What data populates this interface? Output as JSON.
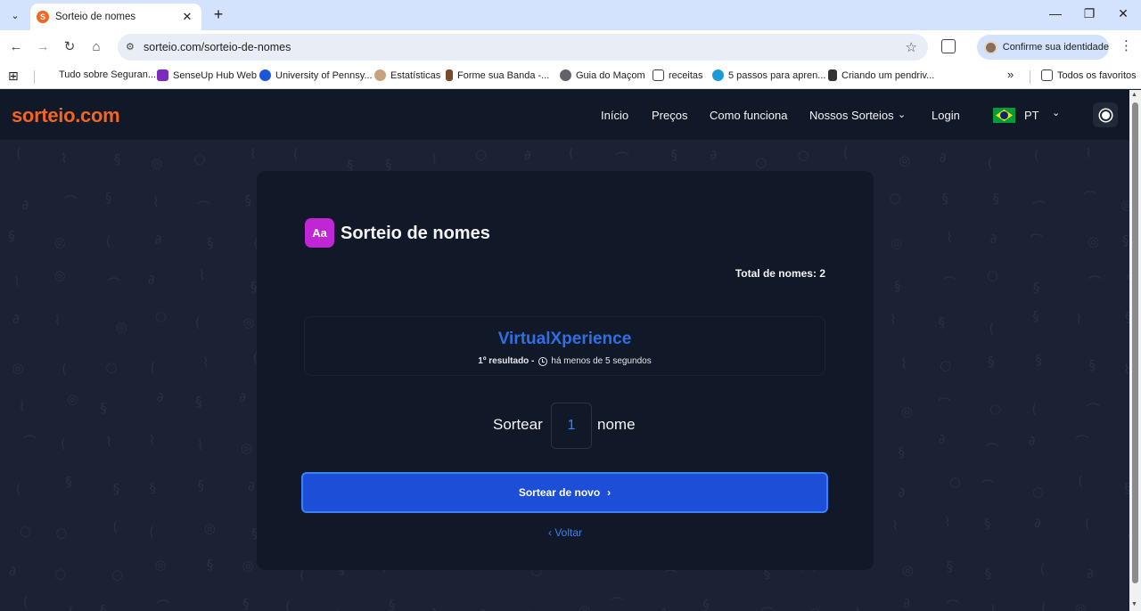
{
  "browser": {
    "tab": {
      "favicon": "S",
      "title": "Sorteio de nomes"
    },
    "address": "sorteio.com/sorteio-de-nomes",
    "profile": "Confirme sua identidade",
    "bookmarks": [
      "Tudo sobre Seguran...",
      "SenseUp Hub Web",
      "University of Pennsy...",
      "Estatísticas",
      "Forme sua Banda -...",
      "Guia do Maçom",
      "receitas",
      "5 passos para apren...",
      "Criando um pendriv..."
    ],
    "all_bookmarks": "Todos os favoritos"
  },
  "site": {
    "brand": "sorteio.com",
    "nav": [
      "Início",
      "Preços",
      "Como funciona",
      "Nossos Sorteios",
      "Login"
    ],
    "language": "PT"
  },
  "card": {
    "icon_text": "Aa",
    "title": "Sorteio de nomes",
    "total": "Total de nomes: 2",
    "result": {
      "name": "VirtualXperience",
      "position": "1º resultado -",
      "time": "há menos de 5 segundos"
    },
    "draw_prefix": "Sortear",
    "quantity": "1",
    "draw_suffix": "nome",
    "redraw_button": "Sortear de novo",
    "back_link": "Voltar"
  },
  "colors": {
    "brand": "#f26522",
    "accent": "#1d4ed8",
    "result": "#2f6fe6",
    "page_bg": "#1a2233",
    "card_bg": "#111827"
  }
}
